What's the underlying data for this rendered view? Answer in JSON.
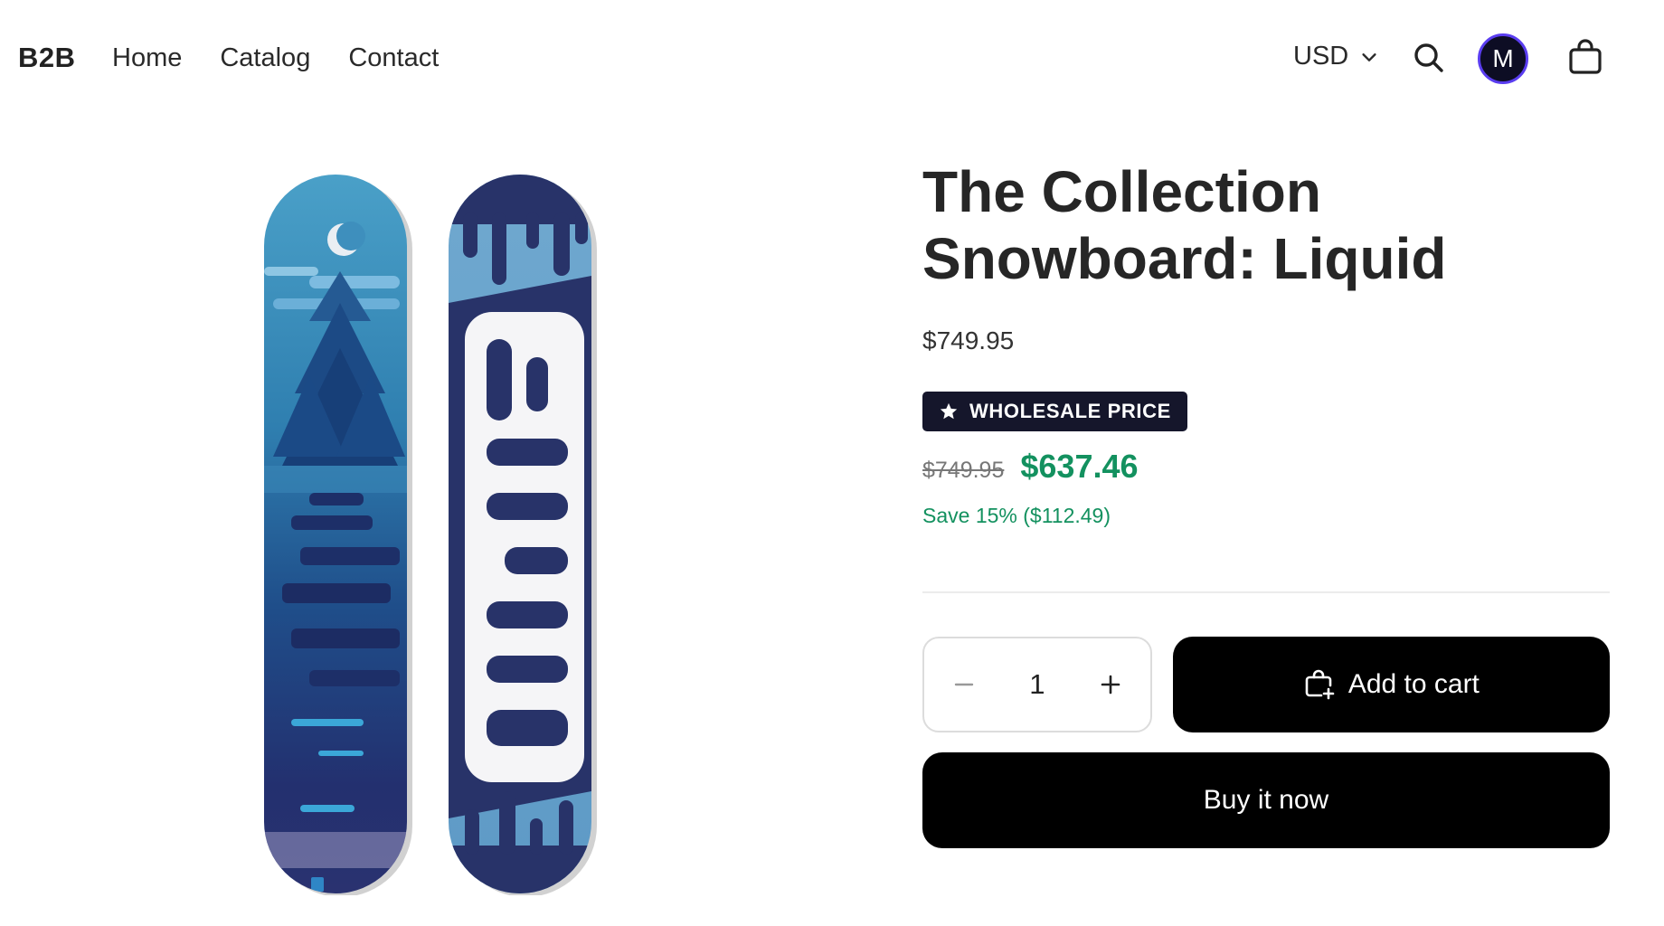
{
  "header": {
    "brand": "B2B",
    "nav": [
      "Home",
      "Catalog",
      "Contact"
    ],
    "currency": "USD",
    "avatar_initial": "M"
  },
  "product": {
    "title": "The Collection Snowboard: Liquid",
    "price": "$749.95",
    "badge": "WHOLESALE PRICE",
    "compare_price": "$749.95",
    "sale_price": "$637.46",
    "savings": "Save 15% ($112.49)",
    "quantity": "1",
    "add_to_cart": "Add to cart",
    "buy_now": "Buy it now"
  },
  "colors": {
    "badge_bg": "#15162b",
    "sale_green": "#13915f",
    "avatar_ring": "#5a3df0",
    "button_bg": "#000000"
  },
  "icons": {
    "currency": "chevron-down-icon",
    "search": "search-icon",
    "cart": "shopping-bag-icon",
    "badge": "star-icon",
    "qty_minus": "minus-icon",
    "qty_plus": "plus-icon",
    "add_to_cart": "bag-plus-icon"
  }
}
